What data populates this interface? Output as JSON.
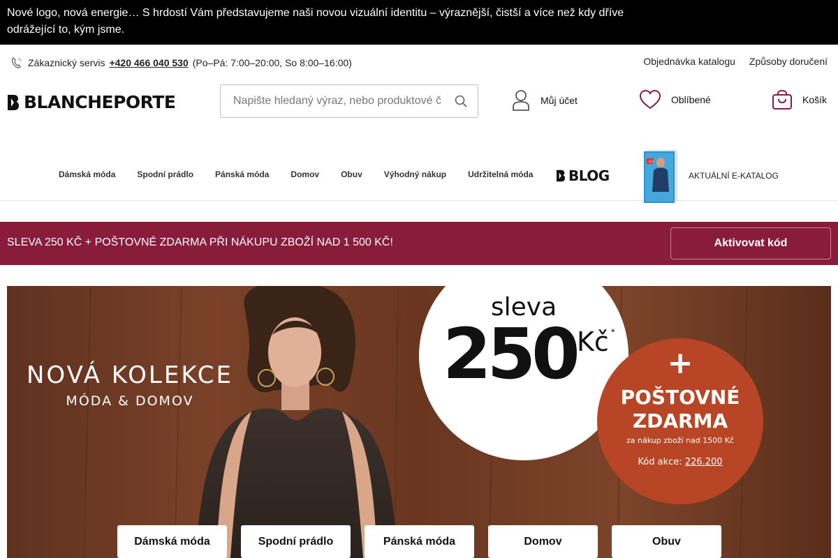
{
  "announcement": {
    "text": "Nové logo, nová energie… S hrdostí Vám představujeme naši novou vizuální identitu – výraznější, čistší a více než kdy dříve odrážející to, kým jsme."
  },
  "utility": {
    "service_label": "Zákaznický servis",
    "phone": "+420 466 040 530",
    "hours": "(Po–Pá: 7:00–20:00, So 8:00–16:00)",
    "links": [
      "Objednávka katalogu",
      "Způsoby doručení"
    ]
  },
  "header": {
    "logo_text": "BLANCHEPORTE",
    "search_placeholder": "Napište hledaný výraz, nebo produktové č",
    "account_label": "Můj účet",
    "favorites_label": "Oblíbené",
    "cart_label": "Košík"
  },
  "nav": {
    "items": [
      "Dámská móda",
      "Spodní prádlo",
      "Pánská móda",
      "Domov",
      "Obuv",
      "Výhodný nákup",
      "Udržitelná móda"
    ],
    "blog_label": "BLOG",
    "ecatalog_label": "AKTUÁLNÍ E-KATALOG",
    "ecatalog_badge": "-50"
  },
  "promo": {
    "text": "SLEVA 250 KČ + POŠTOVNÉ ZDARMA PŘI NÁKUPU ZBOŽÍ NAD 1 500 KČ!",
    "button": "Aktivovat kód"
  },
  "hero": {
    "title": "NOVÁ KOLEKCE",
    "subtitle": "MÓDA & DOMOV",
    "discount": {
      "label": "sleva",
      "amount": "250",
      "currency": "Kč",
      "asterisk": "*"
    },
    "shipping": {
      "plus": "+",
      "line1": "POŠTOVNÉ",
      "line2": "ZDARMA",
      "condition": "za nákup zboží nad 1500 Kč",
      "code_label": "Kód akce:",
      "code_value": "226.200"
    },
    "buttons": [
      "Dámská móda",
      "Spodní prádlo",
      "Pánská móda",
      "Domov",
      "Obuv"
    ]
  },
  "colors": {
    "promo_bg": "#8a1c3b",
    "shipping_circle": "#b84626",
    "announcement_bg": "#000000"
  }
}
